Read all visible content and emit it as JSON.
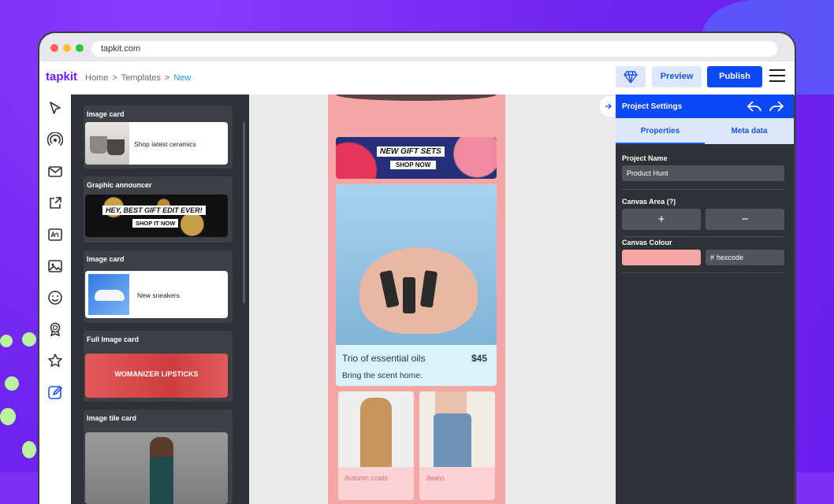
{
  "browser": {
    "url": "tapkit.com"
  },
  "app": {
    "logo": "tapkit",
    "breadcrumb": [
      "Home",
      "Templates",
      "New"
    ],
    "breadcrumb_sep": ">",
    "preview_label": "Preview",
    "publish_label": "Publish"
  },
  "tools": [
    "cursor-icon",
    "broadcast-icon",
    "mail-icon",
    "share-icon",
    "text-icon",
    "image-icon",
    "smiley-icon",
    "badge-icon",
    "star-icon",
    "edit-icon"
  ],
  "panel": {
    "cards": [
      {
        "title": "Image card",
        "text": "Shop latest ceramics"
      },
      {
        "title": "Graphic announcer",
        "text": "HEY, BEST GIFT EDIT EVER!",
        "cta": "SHOP IT NOW"
      },
      {
        "title": "Image card",
        "text": "New sneakers"
      },
      {
        "title": "Full Image card",
        "text": "WOMANIZER LIPSTICKS"
      },
      {
        "title": "Image tile card"
      }
    ]
  },
  "canvas": {
    "banner_title": "NEW GIFT SETS",
    "banner_cta": "SHOP NOW",
    "product_title": "Trio of essential oils",
    "product_price": "$45",
    "product_desc": "Bring the scent home.",
    "tiles": [
      "Autumn coats",
      "Jeans"
    ],
    "background": "#f6a7a5"
  },
  "settings": {
    "title": "Project Settings",
    "tabs": [
      "Properties",
      "Meta data"
    ],
    "project_name_label": "Project Name",
    "project_name_value": "Product Hunt",
    "canvas_area_label": "Canvas Area (?)",
    "plus": "+",
    "minus": "−",
    "canvas_colour_label": "Canvas Colour",
    "hex_prefix": "#",
    "hex_placeholder": "hexcode",
    "swatch_color": "#f6a7a5"
  },
  "colors": {
    "accent": "#0a49f5",
    "brand": "#6a1bff",
    "background": "#7b2ff7"
  }
}
